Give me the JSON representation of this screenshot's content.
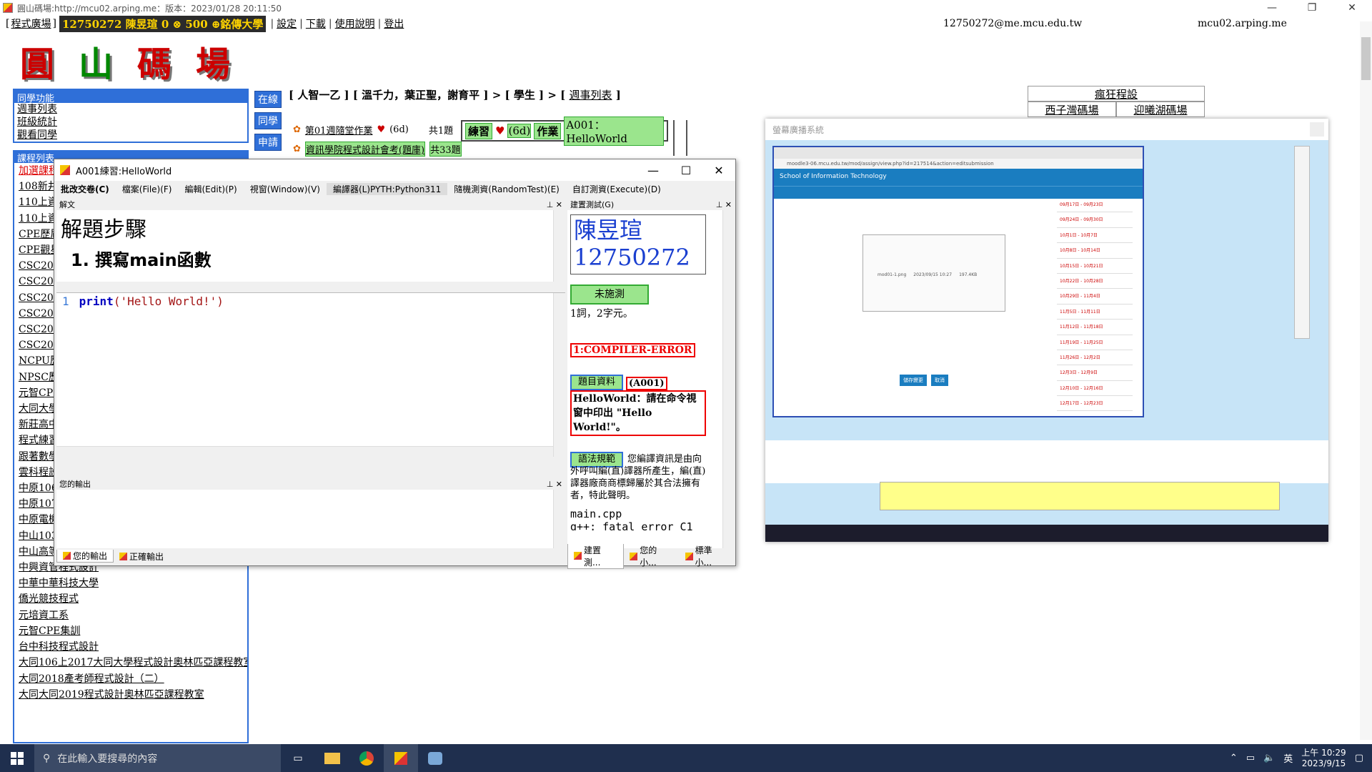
{
  "window": {
    "title": "圓山碼場:http://mcu02.arping.me：版本：2023/01/28 20:11:50"
  },
  "topbar": {
    "plaza": "程式廣場",
    "user_badge": "12750272 陳昱瑄 0 ⊗ 500 ⊕銘傳大學",
    "links": [
      "設定",
      "下載",
      "使用說明",
      "登出"
    ],
    "email": "12750272@me.mcu.edu.tw",
    "server": "mcu02.arping.me"
  },
  "logo": {
    "chars": [
      "圓",
      "山",
      "碼",
      "場"
    ]
  },
  "classmate_panel": {
    "title": "同學功能",
    "items": [
      "週事列表",
      "班級統計",
      "觀看同學"
    ]
  },
  "course_panel": {
    "title": "課程列表",
    "items": [
      "加選課程",
      "108新井",
      "110上資",
      "110上資",
      "CPE歷屆",
      "CPE觀星",
      "CSC201",
      "CSC201",
      "CSC201",
      "CSC201",
      "CSC201",
      "CSC201",
      "NCPU歷",
      "NPSC歷",
      "元智CPE",
      "大同大學",
      "新莊高中",
      "程式練習",
      "跟著數學",
      "雲科程設",
      "中原106",
      "中原107",
      "中原電機",
      "中山103",
      "中山高等程式設計與實作",
      "中興資管程式設計",
      "中華中華科技大學",
      "僑光競技程式",
      "元培資工系",
      "元智CPE集訓",
      "台中科技程式設計",
      "大同106上2017大同大學程式設計奧林匹亞課程教室",
      "大同2018產考師程式設計（二）",
      "大同大同2019程式設計奧林匹亞課程教室"
    ]
  },
  "side_buttons": [
    "在線",
    "同學",
    "申請"
  ],
  "breadcrumb": {
    "prefix": "[ 人智一乙 ] [ 溫千力，葉正聖，謝育平 ] > [ 學生 ] > [ ",
    "link": "週事列表",
    "suffix": " ]"
  },
  "homework": {
    "row1": {
      "title": "第01週隨堂作業",
      "days": "(6d)",
      "count": "共1題"
    },
    "row2": {
      "title": "資訊學院程式設計會考(題庫)",
      "count": "共33題"
    },
    "practice_label": "練習",
    "practice_days": "(6d)",
    "homework_label": "作業",
    "problem": "A001：HelloWorld"
  },
  "right_links": {
    "top": "瘋狂程設",
    "left": "西子灣碼場",
    "right": "迎曦湖碼場"
  },
  "dialog": {
    "title": "A001練習:HelloWorld",
    "menu": [
      "批改交卷(C)",
      "檔案(File)(F)",
      "編輯(Edit)(P)",
      "視窗(Window)(V)",
      "編譯器(L)PYTH:Python311",
      "隨機測資(RandomTest)(E)",
      "自訂測資(Execute)(D)"
    ],
    "solution_pane": "解文",
    "solution_heading": "解題步驟",
    "solution_step": "1. 撰寫main函數",
    "code_line_no": "1",
    "code_keyword": "print",
    "code_args": "('Hello World!')",
    "output_pane": "您的輸出",
    "bottom_tabs": [
      "您的輸出",
      "正確輸出"
    ],
    "build_pane": "建置測試(G)",
    "student_name": "陳昱瑄",
    "student_id": "12750272",
    "status_btn": "未施測",
    "word_count": "1詞，2字元。",
    "error": "1:COMPILER-ERROR",
    "info_btn": "題目資料",
    "problem_id": "(A001)",
    "problem_desc": "HelloWorld：請在命令視窗中印出 \"Hello World!\"。",
    "syntax_btn": "語法規範",
    "syntax_desc": "您編譯資訊是由向外呼叫編(直)譯器所產生，編(直)譯器廠商商標歸屬於其合法擁有者，特此聲明。",
    "compile_file": "main.cpp",
    "compile_msg": "g++: fatal error C1",
    "right_tabs": [
      "建置測...",
      "您的小...",
      "標準小..."
    ]
  },
  "share": {
    "title": "螢幕廣播系統",
    "site": "School of Information Technology",
    "browser_url": "moodle3-06.mcu.edu.tw/mod/assign/view.php?id=217514&action=editsubmission",
    "file_name": "mod01-1.png",
    "file_date": "2023/09/15 10:27",
    "file_size": "197.4KB",
    "save_btn": "儲存變更",
    "cancel_btn": "取消",
    "weeks": [
      "09月17日 - 09月23日",
      "09月24日 - 09月30日",
      "10月1日 - 10月7日",
      "10月8日 - 10月14日",
      "10月15日 - 10月21日",
      "10月22日 - 10月28日",
      "10月29日 - 11月4日",
      "11月5日 - 11月11日",
      "11月12日 - 11月18日",
      "11月19日 - 11月25日",
      "11月26日 - 12月2日",
      "12月3日 - 12月9日",
      "12月10日 - 12月16日",
      "12月17日 - 12月23日"
    ]
  },
  "taskbar": {
    "search_placeholder": "在此輸入要搜尋的內容",
    "ime": "英",
    "time": "上午 10:29",
    "date": "2023/9/15"
  },
  "colors": {
    "accent": "#2f6fd8",
    "badge_bg": "#2b2b2b",
    "badge_fg": "#ffd400",
    "error": "#e00000",
    "green": "#9be58d"
  }
}
